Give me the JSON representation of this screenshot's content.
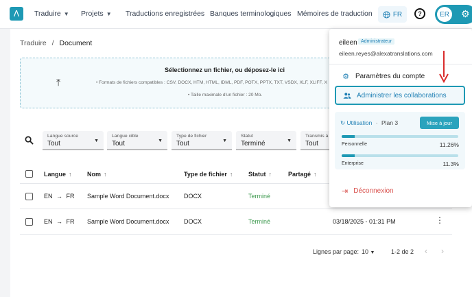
{
  "nav": {
    "logo_glyph": "Λ",
    "items": [
      {
        "label": "Traduire",
        "dropdown": true
      },
      {
        "label": "Projets",
        "dropdown": true
      },
      {
        "label": "Traductions enregistrées",
        "dropdown": false
      },
      {
        "label": "Banques terminologiques",
        "dropdown": false
      },
      {
        "label": "Mémoires de traduction",
        "dropdown": false
      }
    ],
    "language": "FR",
    "help_glyph": "?",
    "user_initials": "ER"
  },
  "breadcrumb": {
    "root": "Traduire",
    "separator": "/",
    "current": "Document"
  },
  "dropzone": {
    "title": "Sélectionnez un fichier, ou déposez-le ici",
    "formats": "Formats de fichiers compatibles : CSV, DOCX, HTM, HTML, IDML, PDF, POTX, PPTX, TXT, VSDX, XLF, XLIFF, X",
    "max_size": "Taille maximale d'un fichier : 20 Mo."
  },
  "filters": [
    {
      "label": "Langue source",
      "value": "Tout"
    },
    {
      "label": "Langue cible",
      "value": "Tout"
    },
    {
      "label": "Type de fichier",
      "value": "Tout"
    },
    {
      "label": "Statut",
      "value": "Terminé"
    },
    {
      "label": "Transmis à",
      "value": "Tout"
    }
  ],
  "table": {
    "headers": {
      "lang": "Langue",
      "name": "Nom",
      "type": "Type de fichier",
      "status": "Statut",
      "shared": "Partagé"
    },
    "sort_glyph": "↑",
    "rows": [
      {
        "src": "EN",
        "arrow": "→",
        "tgt": "FR",
        "name": "Sample Word Document.docx",
        "type": "DOCX",
        "status": "Terminé",
        "date": ""
      },
      {
        "src": "EN",
        "arrow": "→",
        "tgt": "FR",
        "name": "Sample Word Document.docx",
        "type": "DOCX",
        "status": "Terminé",
        "date": "03/18/2025 - 01:31 PM"
      }
    ]
  },
  "pagination": {
    "rows_label": "Lignes par page:",
    "rows_value": "10",
    "range": "1-2 de 2"
  },
  "account_menu": {
    "name": "eileen",
    "role": "Administrateur",
    "email": "eileen.reyes@alexatranslations.com",
    "items": [
      {
        "label": "Paramètres du compte",
        "icon": "gear-icon",
        "active": false
      },
      {
        "label": "Administrer les collaborations",
        "icon": "users-icon",
        "active": true
      }
    ],
    "usage": {
      "label": "Utilisation",
      "separator": "·",
      "plan": "Plan 3",
      "upgrade_label": "Mise à jour",
      "bars": [
        {
          "name": "Personnelle",
          "percent_label": "11.26%",
          "percent": 11.26
        },
        {
          "name": "Enterprise",
          "percent_label": "11.3%",
          "percent": 11.3
        }
      ]
    },
    "logout_label": "Déconnexion"
  },
  "colors": {
    "accent": "#1e99b4",
    "success": "#3f9a50",
    "danger": "#d9534f",
    "annotation": "#d92b2b"
  }
}
